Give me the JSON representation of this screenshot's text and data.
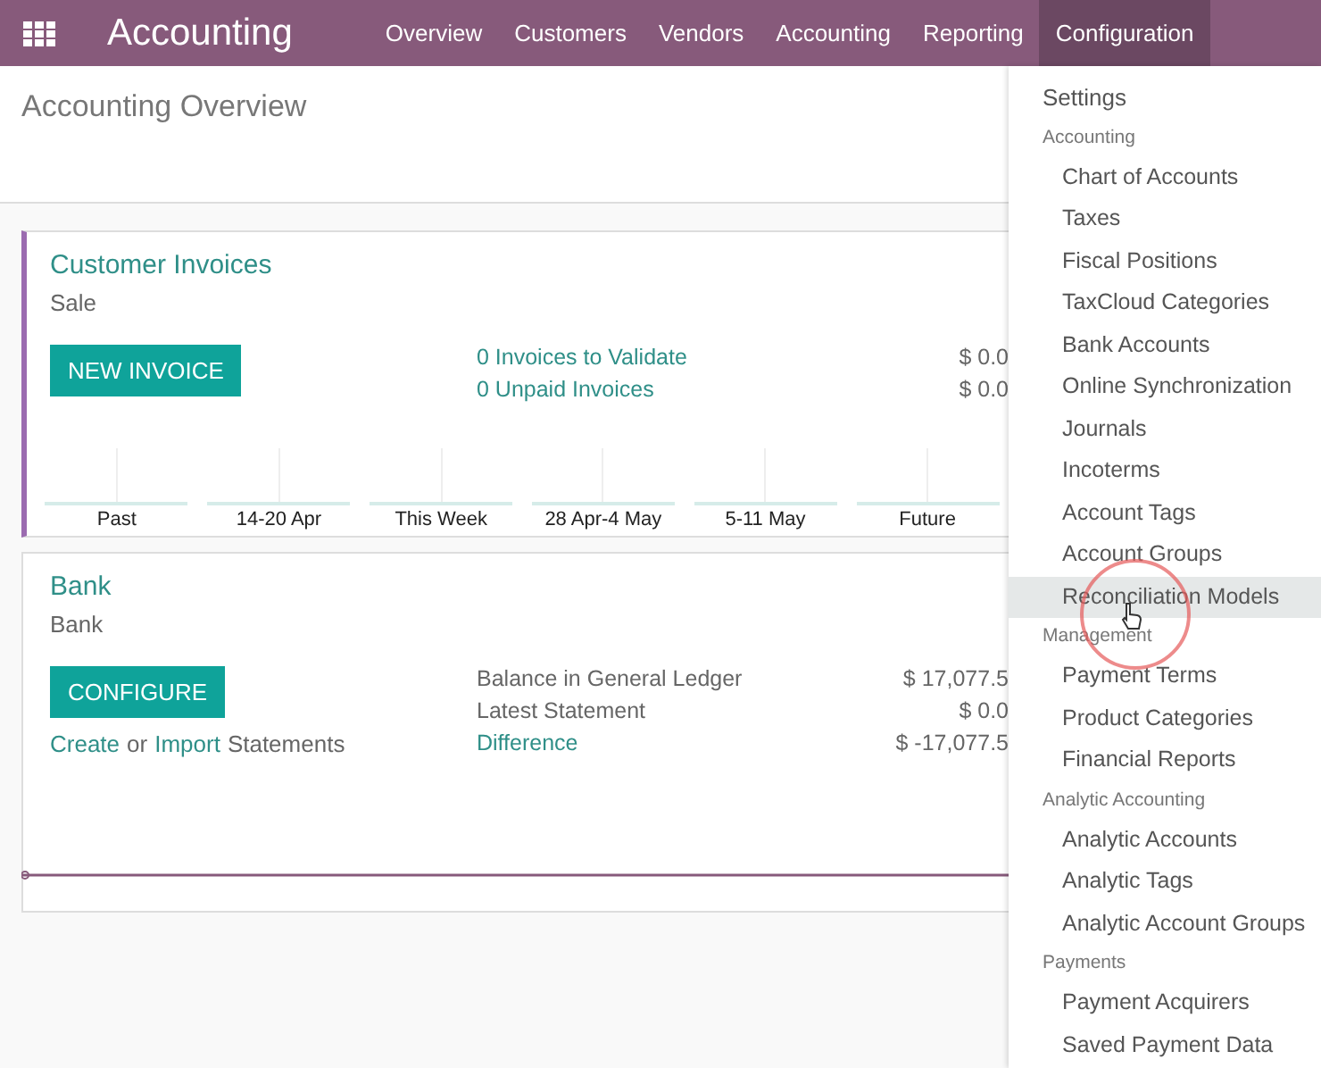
{
  "navbar": {
    "app_title": "Accounting",
    "menus": [
      {
        "label": "Overview",
        "selected": false
      },
      {
        "label": "Customers",
        "selected": false
      },
      {
        "label": "Vendors",
        "selected": false
      },
      {
        "label": "Accounting",
        "selected": false
      },
      {
        "label": "Reporting",
        "selected": false
      },
      {
        "label": "Configuration",
        "selected": true
      }
    ]
  },
  "breadcrumb": "Accounting Overview",
  "customer_invoices": {
    "title": "Customer Invoices",
    "subtitle": "Sale",
    "button": "NEW INVOICE",
    "stats": [
      {
        "label": "0 Invoices to Validate",
        "amount": "$ 0.0"
      },
      {
        "label": "0 Unpaid Invoices",
        "amount": "$ 0.0"
      }
    ],
    "graph_labels": [
      "Past",
      "14-20 Apr",
      "This Week",
      "28 Apr-4 May",
      "5-11 May",
      "Future"
    ]
  },
  "bank": {
    "title": "Bank",
    "subtitle": "Bank",
    "button": "CONFIGURE",
    "create_link": "Create",
    "or_text": "or",
    "import_link": "Import",
    "statements_text": "Statements",
    "stats": [
      {
        "label": "Balance in General Ledger",
        "amount": "$ 17,077.5",
        "kind": "plain"
      },
      {
        "label": "Latest Statement",
        "amount": "$ 0.0",
        "kind": "plain"
      },
      {
        "label": "Difference",
        "amount": "$ -17,077.5",
        "kind": "link"
      }
    ]
  },
  "config_menu": [
    {
      "kind": "top_item",
      "label": "Settings",
      "selected": false
    },
    {
      "kind": "header",
      "label": "Accounting"
    },
    {
      "kind": "item",
      "label": "Chart of Accounts",
      "selected": false
    },
    {
      "kind": "item",
      "label": "Taxes",
      "selected": false
    },
    {
      "kind": "item",
      "label": "Fiscal Positions",
      "selected": false
    },
    {
      "kind": "item",
      "label": "TaxCloud Categories",
      "selected": false
    },
    {
      "kind": "item",
      "label": "Bank Accounts",
      "selected": false
    },
    {
      "kind": "item",
      "label": "Online Synchronization",
      "selected": false
    },
    {
      "kind": "item",
      "label": "Journals",
      "selected": false
    },
    {
      "kind": "item",
      "label": "Incoterms",
      "selected": false
    },
    {
      "kind": "item",
      "label": "Account Tags",
      "selected": false
    },
    {
      "kind": "item",
      "label": "Account Groups",
      "selected": false
    },
    {
      "kind": "item",
      "label": "Reconciliation Models",
      "selected": true
    },
    {
      "kind": "header",
      "label": "Management"
    },
    {
      "kind": "item",
      "label": "Payment Terms",
      "selected": false
    },
    {
      "kind": "item",
      "label": "Product Categories",
      "selected": false
    },
    {
      "kind": "item",
      "label": "Financial Reports",
      "selected": false
    },
    {
      "kind": "header",
      "label": "Analytic Accounting"
    },
    {
      "kind": "item",
      "label": "Analytic Accounts",
      "selected": false
    },
    {
      "kind": "item",
      "label": "Analytic Tags",
      "selected": false
    },
    {
      "kind": "item",
      "label": "Analytic Account Groups",
      "selected": false
    },
    {
      "kind": "header",
      "label": "Payments"
    },
    {
      "kind": "item",
      "label": "Payment Acquirers",
      "selected": false
    },
    {
      "kind": "item",
      "label": "Saved Payment Data",
      "selected": false
    }
  ]
}
